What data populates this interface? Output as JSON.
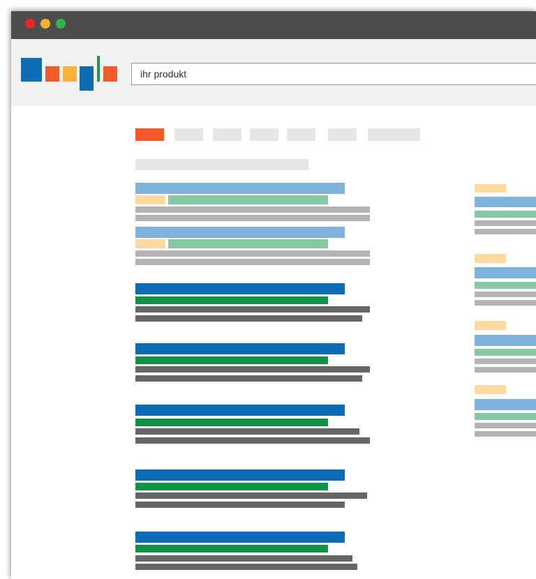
{
  "window": {
    "controls": [
      "close",
      "minimize",
      "maximize"
    ]
  },
  "search": {
    "query": "ihr produkt"
  },
  "colors": {
    "titlebar": "#4d4d4d",
    "toolbar": "#f1f1f1",
    "accent_orange": "#f15a24",
    "logo_blue": "#0f6db5",
    "logo_yellow": "#fbb03b",
    "logo_green": "#1f9b46",
    "ad_title_blue": "#7fb3dc",
    "ad_label_peach": "#fdd9a0",
    "ad_url_green": "#84c9a1",
    "result_title_blue": "#0b6bb4",
    "result_url_green": "#0f9246",
    "snippet_dark": "#666666",
    "snippet_light": "#b3b3b3",
    "placeholder_gray": "#e6e6e6"
  },
  "tabs": {
    "count": 7,
    "active_index": 0
  },
  "ads_top": {
    "count": 2
  },
  "organic_results": {
    "count": 5
  },
  "ads_side": {
    "count": 4
  }
}
